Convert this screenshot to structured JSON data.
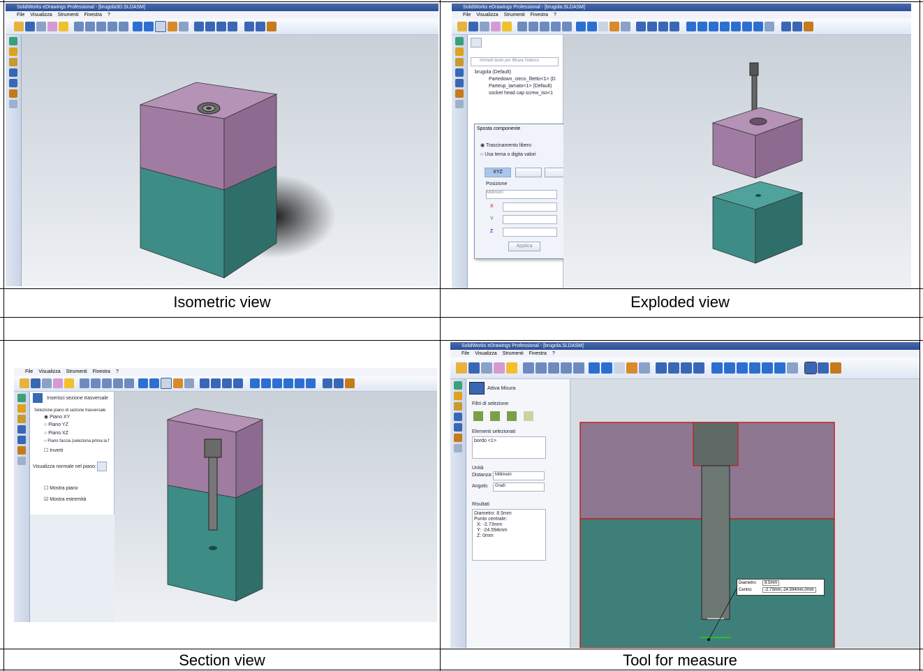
{
  "app": {
    "title_iso": "SolidWorks eDrawings Professional - [brugola3D.SLDASM]",
    "title_expl": "SolidWorks eDrawings Professional - [brugola.SLDASM]",
    "title_meas": "SolidWorks eDrawings Professional - [brugola.SLDASM]",
    "menu": [
      "File",
      "Visualizza",
      "Strumenti",
      "Finestra",
      "?"
    ]
  },
  "captions": {
    "iso": "Isometric view",
    "expl": "Exploded view",
    "section": "Section view",
    "measure": "Tool for measure"
  },
  "exploded": {
    "filter_placeholder": "Immetti testo per filtrare l'elenco",
    "tree": [
      "brugola (Default)",
      "Partedown_cieco_filetto<1> (D",
      "Parteup_lamato<1> (Default)",
      "socket head cap screw_iso<1"
    ],
    "dialog": {
      "title": "Sposta componente",
      "opt1": "Trascinamento libero",
      "opt2": "Usa terna o digita valori",
      "xyz": "XYZ",
      "position": "Posizione",
      "unit": "Millimetri",
      "x": "X",
      "y": "Y",
      "z": "Z",
      "apply": "Applica"
    }
  },
  "section": {
    "insert": "Inserisci sezione trasversale",
    "select": "Selezione piano di sezione trasversale",
    "planes": [
      "Piano XY",
      "Piano YZ",
      "Piano XZ",
      "Piano faccia (seleziona prima la f"
    ],
    "invert": "Inverti",
    "normal": "Visualizza normale nel piano:",
    "show_plane": "Mostra piano",
    "show_ends": "Mostra estremità"
  },
  "measure": {
    "activate": "Attiva Misura",
    "filters": "Filtri di selezione",
    "selected": "Elementi selezionati",
    "selected_val": "bordo <1>",
    "units": "Unità",
    "distance": "Distanza:",
    "distance_val": "Millimetri",
    "angle": "Angolo:",
    "angle_val": "Gradi",
    "results": "Risultati",
    "res_lines": [
      "Diametro: 8.5mm",
      "Punto centrale:",
      "X: -2.73mm",
      "Y: -24.594mm",
      "Z: 0mm"
    ],
    "tip_diam_label": "Diametro:",
    "tip_diam_val": "8.5mm",
    "tip_center_label": "Centro:",
    "tip_center_val": "-2.73mm,-24.594mm,0mm"
  },
  "colors": {
    "purple": "#9c7aa0",
    "teal": "#3d8c86",
    "bg": "#dde2e8"
  }
}
